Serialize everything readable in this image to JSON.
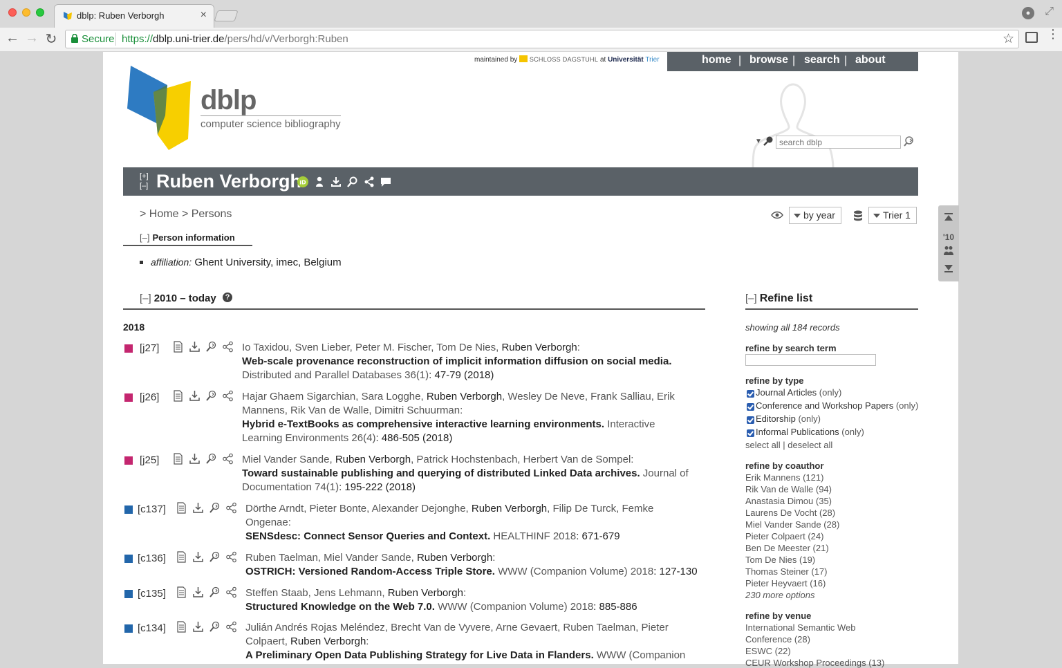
{
  "browser": {
    "tab_title": "dblp: Ruben Verborgh",
    "tab_close": "×",
    "secure_label": "Secure",
    "url_scheme": "https://",
    "url_host": "dblp.uni-trier.de",
    "url_path": "/pers/hd/v/Verborgh:Ruben",
    "back": "←",
    "forward": "→",
    "reload": "↻",
    "star": "☆",
    "menu": "⋮",
    "expand": "⤢"
  },
  "header": {
    "maintained_by": "maintained by",
    "dagstuhl": "SCHLOSS DAGSTUHL",
    "at": "at",
    "universitat": "Universität",
    "trier": "Trier",
    "nav": [
      "home",
      "browse",
      "search",
      "about"
    ],
    "logo_title": "dblp",
    "logo_subtitle": "computer science bibliography",
    "search_placeholder": "search dblp"
  },
  "person": {
    "expand": "[+]",
    "collapse": "[–]",
    "name": "Ruben Verborgh",
    "breadcrumb_prefix": ">",
    "breadcrumb_home": "Home",
    "breadcrumb_sep": ">",
    "breadcrumb_persons": "Persons",
    "view_select": "by year",
    "mirror_select": "Trier 1",
    "info_toggle": "[–]",
    "info_heading": "Person information",
    "affiliation_label": "affiliation:",
    "affiliation_value": "Ghent University, imec, Belgium"
  },
  "publications": {
    "toggle": "[–]",
    "range_heading": "2010 – today",
    "help": "?",
    "year": "2018",
    "colors": {
      "journal": "#c4266f",
      "conference": "#2266aa"
    }
  },
  "refine": {
    "toggle": "[–]",
    "heading": "Refine list",
    "showing": "showing all 184 records",
    "by_term": "refine by search term",
    "by_type": "refine by type",
    "types": [
      {
        "label": "Journal Articles",
        "only": "(only)"
      },
      {
        "label": "Conference and Workshop Papers",
        "only": "(only)"
      },
      {
        "label": "Editorship",
        "only": "(only)"
      },
      {
        "label": "Informal Publications",
        "only": "(only)"
      }
    ],
    "select_all": "select all",
    "sel_sep": "|",
    "deselect_all": "deselect all",
    "by_coauthor": "refine by coauthor",
    "coauthors": [
      "Erik Mannens (121)",
      "Rik Van de Walle (94)",
      "Anastasia Dimou (35)",
      "Laurens De Vocht (28)",
      "Miel Vander Sande (28)",
      "Pieter Colpaert (24)",
      "Ben De Meester (21)",
      "Tom De Nies (19)",
      "Thomas Steiner (17)",
      "Pieter Heyvaert (16)"
    ],
    "more_options": "230 more options",
    "by_venue": "refine by venue",
    "venues": [
      "International Semantic Web",
      "Conference (28)",
      "ESWC (22)",
      "CEUR Workshop Proceedings (13)"
    ]
  },
  "sidenav": {
    "year": "'10"
  },
  "entries": {
    "j27": {
      "key": "[j27]",
      "a1": "Io Taxidou, Sven Lieber, Peter M. Fischer, Tom De Nies, ",
      "me": "Ruben Verborgh",
      "a2": ":",
      "title": "Web-scale provenance reconstruction of implicit information diffusion on social media.",
      "venue": "Distributed and Parallel Databases 36(1)",
      "pages": ": 47-79 (2018)"
    },
    "j26": {
      "key": "[j26]",
      "l1a": "Hajar Ghaem Sigarchian, Sara Logghe, ",
      "me": "Ruben Verborgh",
      "l1b": ", Wesley De Neve, Frank Salliau, Erik",
      "l2": "Mannens, Rik Van de Walle, Dimitri Schuurman:",
      "title": "Hybrid e-TextBooks as comprehensive interactive learning environments.",
      "venue1": " Interactive",
      "venue2": "Learning Environments 26(4)",
      "pages": ": 486-505 (2018)"
    },
    "j25": {
      "key": "[j25]",
      "a1": "Miel Vander Sande, ",
      "me": "Ruben Verborgh",
      "a2": ", Patrick Hochstenbach, Herbert Van de Sompel:",
      "title": "Toward sustainable publishing and querying of distributed Linked Data archives.",
      "venue1": " Journal of",
      "venue2": "Documentation 74(1)",
      "pages": ": 195-222 (2018)"
    },
    "c137": {
      "key": "[c137]",
      "a1": "Dörthe Arndt, Pieter Bonte, Alexander Dejonghe, ",
      "me": "Ruben Verborgh",
      "a2": ", Filip De Turck, Femke",
      "l2": "Ongenae:",
      "title": "SENSdesc: Connect Sensor Queries and Context.",
      "venue": " HEALTHINF 2018",
      "pages": ": 671-679"
    },
    "c136": {
      "key": "[c136]",
      "a1": "Ruben Taelman, Miel Vander Sande, ",
      "me": "Ruben Verborgh",
      "a2": ":",
      "title": "OSTRICH: Versioned Random-Access Triple Store.",
      "venue": " WWW (Companion Volume) 2018",
      "pages": ": 127-130"
    },
    "c135": {
      "key": "[c135]",
      "a1": "Steffen Staab, Jens Lehmann, ",
      "me": "Ruben Verborgh",
      "a2": ":",
      "title": "Structured Knowledge on the Web 7.0.",
      "venue": " WWW (Companion Volume) 2018",
      "pages": ": 885-886"
    },
    "c134": {
      "key": "[c134]",
      "a1": "Julián Andrés Rojas Meléndez, Brecht Van de Vyvere, Arne Gevaert, Ruben Taelman, Pieter",
      "l2a": "Colpaert, ",
      "me": "Ruben Verborgh",
      "l2b": ":",
      "title": "A Preliminary Open Data Publishing Strategy for Live Data in Flanders.",
      "venue": " WWW (Companion"
    }
  }
}
